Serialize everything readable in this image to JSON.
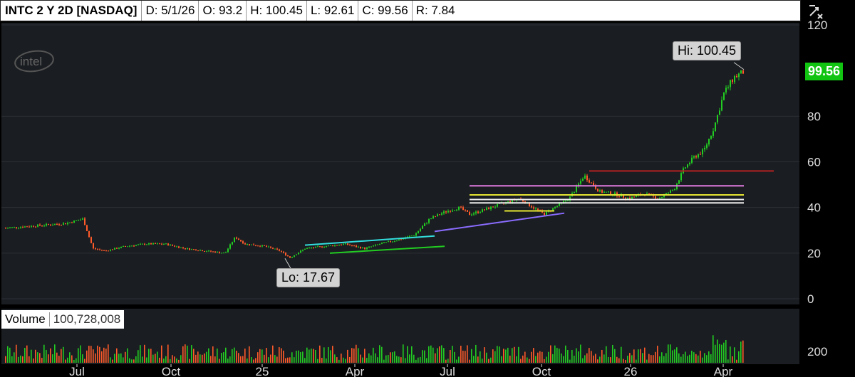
{
  "header": {
    "symbol": "INTC 2 Y 2D [NASDAQ]",
    "date": "D: 5/1/26",
    "open": "O: 93.2",
    "high": "H: 100.45",
    "low": "L: 92.61",
    "close": "C: 99.56",
    "range": "R: 7.84"
  },
  "logo": "intel",
  "volume": {
    "label": "Volume",
    "value": "100,728,008",
    "axis_tick": "200"
  },
  "hi_label": "Hi: 100.45",
  "lo_label": "Lo: 17.67",
  "last_price": "99.56",
  "colors": {
    "up": "#22cc22",
    "down": "#ff5a2a",
    "background": "#1a1d21",
    "grid": "#2c3036",
    "cyan": "#33dddd",
    "green": "#22cc22",
    "purple": "#8a6cff",
    "magenta": "#e07be0",
    "yellow": "#e6e633",
    "white": "#eeeeee",
    "red": "#b22222"
  },
  "chart_data": {
    "type": "candlestick",
    "ylim": [
      0,
      120
    ],
    "yticks": [
      0,
      20,
      40,
      60,
      80,
      120
    ],
    "xticks": [
      "Jul",
      "Oct",
      "25",
      "Apr",
      "Jul",
      "Oct",
      "26",
      "Apr"
    ],
    "price_path": [
      [
        0,
        31
      ],
      [
        0.06,
        32
      ],
      [
        0.12,
        33
      ],
      [
        0.155,
        35
      ],
      [
        0.175,
        22
      ],
      [
        0.2,
        21
      ],
      [
        0.24,
        23
      ],
      [
        0.28,
        24
      ],
      [
        0.32,
        24
      ],
      [
        0.36,
        22
      ],
      [
        0.4,
        21
      ],
      [
        0.44,
        20
      ],
      [
        0.46,
        27
      ],
      [
        0.48,
        24
      ],
      [
        0.52,
        23
      ],
      [
        0.55,
        21
      ],
      [
        0.57,
        18
      ],
      [
        0.6,
        22
      ],
      [
        0.64,
        23
      ],
      [
        0.68,
        24
      ],
      [
        0.72,
        22
      ],
      [
        0.75,
        24
      ],
      [
        0.79,
        26
      ],
      [
        0.82,
        28
      ],
      [
        0.85,
        35
      ],
      [
        0.88,
        38
      ],
      [
        0.91,
        40
      ],
      [
        0.93,
        37
      ],
      [
        0.96,
        39
      ],
      [
        1.0,
        42
      ],
      [
        1.03,
        44
      ],
      [
        1.05,
        41
      ],
      [
        1.08,
        37
      ],
      [
        1.1,
        40
      ],
      [
        1.13,
        44
      ],
      [
        1.16,
        54
      ],
      [
        1.19,
        47
      ],
      [
        1.22,
        46
      ],
      [
        1.25,
        44
      ],
      [
        1.28,
        46
      ],
      [
        1.31,
        44
      ],
      [
        1.34,
        48
      ],
      [
        1.36,
        57
      ],
      [
        1.38,
        62
      ],
      [
        1.4,
        65
      ],
      [
        1.42,
        75
      ],
      [
        1.44,
        90
      ],
      [
        1.46,
        97
      ],
      [
        1.48,
        99.56
      ]
    ],
    "high": 100.45,
    "low": 17.67,
    "last": 99.56
  },
  "trendlines": [
    {
      "color": "cyan",
      "from": [
        0.6,
        23.5
      ],
      "to": [
        0.86,
        27.5
      ]
    },
    {
      "color": "green",
      "from": [
        0.65,
        20
      ],
      "to": [
        0.88,
        23
      ]
    },
    {
      "color": "purple",
      "from": [
        0.86,
        29.5
      ],
      "to": [
        1.12,
        37.5
      ]
    },
    {
      "color": "magenta",
      "from": [
        0.93,
        49.5
      ],
      "to": [
        1.48,
        49.5
      ]
    },
    {
      "color": "yellow",
      "from": [
        0.93,
        45.5
      ],
      "to": [
        1.48,
        45.5
      ]
    },
    {
      "color": "white",
      "from": [
        0.93,
        43.5
      ],
      "to": [
        1.48,
        43.5
      ]
    },
    {
      "color": "white",
      "from": [
        0.93,
        42
      ],
      "to": [
        1.48,
        42
      ]
    },
    {
      "color": "red",
      "from": [
        1.17,
        56
      ],
      "to": [
        1.54,
        56
      ]
    },
    {
      "color": "yellow",
      "from": [
        1.0,
        38.5
      ],
      "to": [
        1.1,
        38.5
      ]
    }
  ]
}
